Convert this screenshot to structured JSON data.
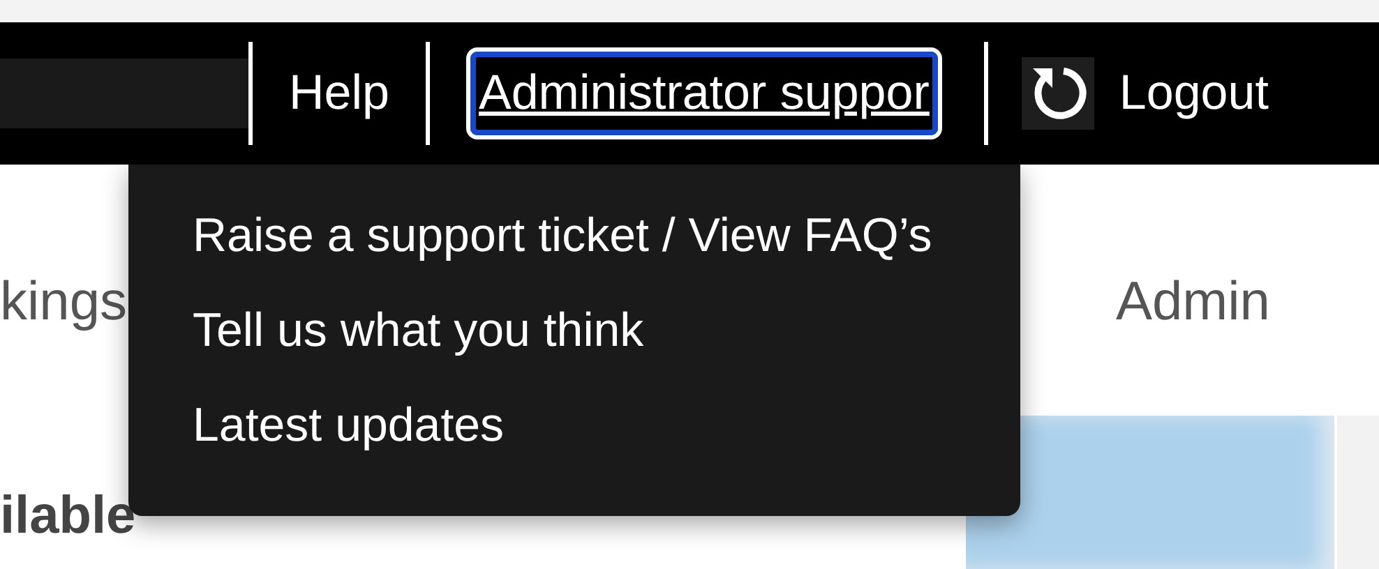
{
  "header": {
    "links": [
      {
        "kind": "link",
        "label": "Help"
      },
      {
        "kind": "link",
        "label": "Administrator suppor",
        "focused": true
      },
      {
        "kind": "logout",
        "label": "Logout"
      }
    ]
  },
  "dropdown": {
    "items": [
      {
        "label": "Raise a support ticket / View FAQ’s"
      },
      {
        "label": "Tell us what you think"
      },
      {
        "label": "Latest updates"
      }
    ]
  },
  "page": {
    "tabs": [
      {
        "label": "kings"
      },
      {
        "label": "Admin"
      }
    ],
    "heading": "ilable"
  }
}
